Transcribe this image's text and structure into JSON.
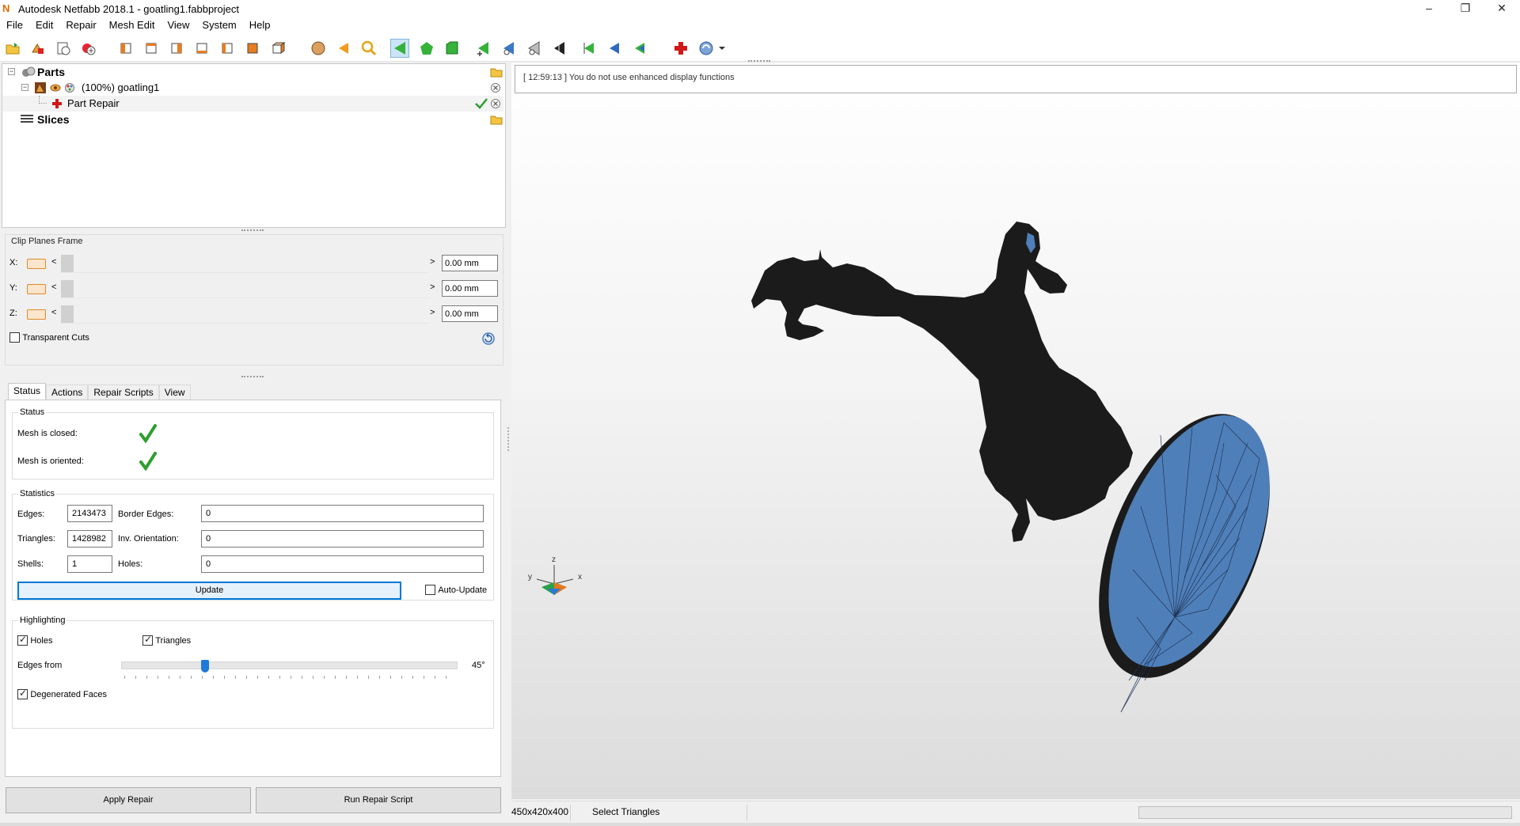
{
  "window": {
    "title": "Autodesk Netfabb 2018.1 - goatling1.fabbproject",
    "app_icon_letter": "N",
    "minimize": "–",
    "maximize": "❐",
    "close": "✕"
  },
  "menu": [
    "File",
    "Edit",
    "Repair",
    "Mesh Edit",
    "View",
    "System",
    "Help"
  ],
  "tree": {
    "parts_label": "Parts",
    "part_label": "(100%) goatling1",
    "repair_label": "Part Repair",
    "slices_label": "Slices"
  },
  "clip": {
    "title": "Clip Planes Frame",
    "rows": [
      {
        "axis": "X:",
        "value": "0.00 mm"
      },
      {
        "axis": "Y:",
        "value": "0.00 mm"
      },
      {
        "axis": "Z:",
        "value": "0.00 mm"
      }
    ],
    "lt": "<",
    "gt": ">",
    "transparent_label": "Transparent Cuts"
  },
  "tabs": [
    "Status",
    "Actions",
    "Repair Scripts",
    "View"
  ],
  "status": {
    "group_title": "Status",
    "closed_label": "Mesh is closed:",
    "oriented_label": "Mesh is oriented:"
  },
  "statistics": {
    "group_title": "Statistics",
    "edges_label": "Edges:",
    "edges": "2143473",
    "border_edges_label": "Border Edges:",
    "border_edges": "0",
    "triangles_label": "Triangles:",
    "triangles": "1428982",
    "inv_orientation_label": "Inv. Orientation:",
    "inv_orientation": "0",
    "shells_label": "Shells:",
    "shells": "1",
    "holes_label": "Holes:",
    "holes": "0",
    "update_label": "Update",
    "auto_update_label": "Auto-Update"
  },
  "highlighting": {
    "group_title": "Highlighting",
    "holes_label": "Holes",
    "holes_checked": true,
    "triangles_label": "Triangles",
    "triangles_checked": true,
    "edges_from_label": "Edges from",
    "edges_from_value": "45°",
    "edges_from_fraction": 0.25,
    "degenerated_label": "Degenerated Faces",
    "degenerated_checked": true
  },
  "buttons": {
    "apply_repair": "Apply Repair",
    "run_script": "Run Repair Script"
  },
  "log": {
    "message": "[ 12:59:13 ] You do not use enhanced display functions"
  },
  "axes_gizmo": {
    "x": "x",
    "y": "y",
    "z": "z"
  },
  "statusbar": {
    "dimensions": "450x420x400",
    "mode": "Select Triangles"
  },
  "colors": {
    "model": "#1b1b1b",
    "base_disc": "#4f7fb9",
    "accent": "#0078d7",
    "check_green": "#2e9e2e",
    "repair_red": "#d01818"
  }
}
